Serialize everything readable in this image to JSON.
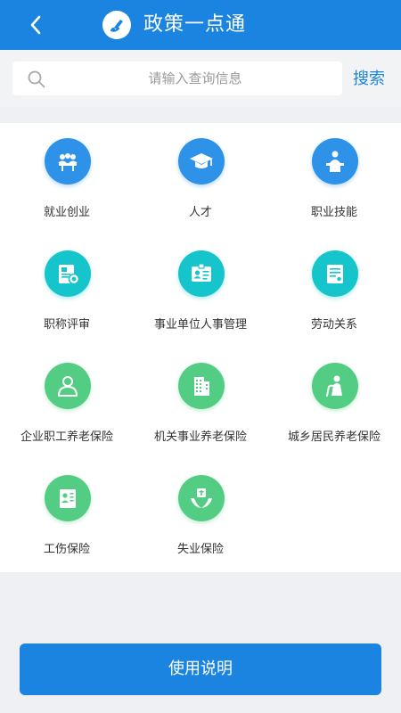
{
  "header": {
    "title": "政策一点通",
    "back_icon": "chevron-left-icon",
    "logo_icon": "pen-logo-icon",
    "background": "#1b84e0"
  },
  "search": {
    "placeholder": "请输入查询信息",
    "button_label": "搜索",
    "icon": "search-icon"
  },
  "categories": [
    {
      "label": "就业创业",
      "icon": "meeting-icon",
      "color": "#2e92e8"
    },
    {
      "label": "人才",
      "icon": "graduation-cap-icon",
      "color": "#2e92e8"
    },
    {
      "label": "职业技能",
      "icon": "lecturer-podium-icon",
      "color": "#2e92e8"
    },
    {
      "label": "职称评审",
      "icon": "certificate-icon",
      "color": "#16c4cb"
    },
    {
      "label": "事业单位人事管理",
      "icon": "id-card-icon",
      "color": "#16c4cb"
    },
    {
      "label": "劳动关系",
      "icon": "contract-document-icon",
      "color": "#16c4cb"
    },
    {
      "label": "企业职工养老保险",
      "icon": "user-outline-icon",
      "color": "#54cd84"
    },
    {
      "label": "机关事业养老保险",
      "icon": "office-building-icon",
      "color": "#54cd84"
    },
    {
      "label": "城乡居民养老保险",
      "icon": "elderly-person-icon",
      "color": "#54cd84"
    },
    {
      "label": "工伤保险",
      "icon": "injury-document-icon",
      "color": "#54cd84"
    },
    {
      "label": "失业保险",
      "icon": "hands-protect-icon",
      "color": "#54cd84"
    }
  ],
  "footer": {
    "button_label": "使用说明"
  }
}
